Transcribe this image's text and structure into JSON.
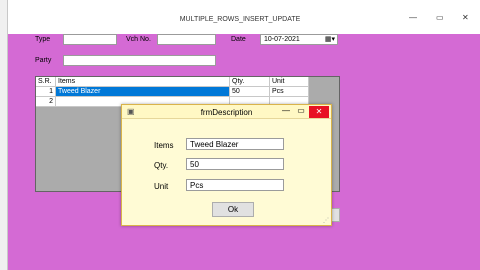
{
  "window": {
    "title": "MULTIPLE_ROWS_INSERT_UPDATE",
    "min": "—",
    "max": "▭",
    "close": "✕"
  },
  "form": {
    "type_label": "Type",
    "vch_label": "Vch No.",
    "date_label": "Date",
    "date_value": "10-07-2021",
    "party_label": "Party"
  },
  "grid": {
    "headers": [
      "S.R.",
      "Items",
      "Qty.",
      "Unit"
    ],
    "rows": [
      {
        "sr": "1",
        "item": "Tweed Blazer",
        "qty": "50",
        "unit": "Pcs"
      },
      {
        "sr": "2",
        "item": "",
        "qty": "",
        "unit": ""
      }
    ]
  },
  "dialog": {
    "title": "frmDescription",
    "items_label": "Items",
    "items_value": "Tweed Blazer",
    "qty_label": "Qty.",
    "qty_value": "50",
    "unit_label": "Unit",
    "unit_value": "Pcs",
    "ok_label": "Ok",
    "min": "—",
    "max": "▭",
    "close": "✕"
  },
  "colors": {
    "form_bg": "#d46ad4",
    "dialog_bg": "#fffbd5",
    "selection": "#0078d7",
    "close_red": "#e81123"
  }
}
